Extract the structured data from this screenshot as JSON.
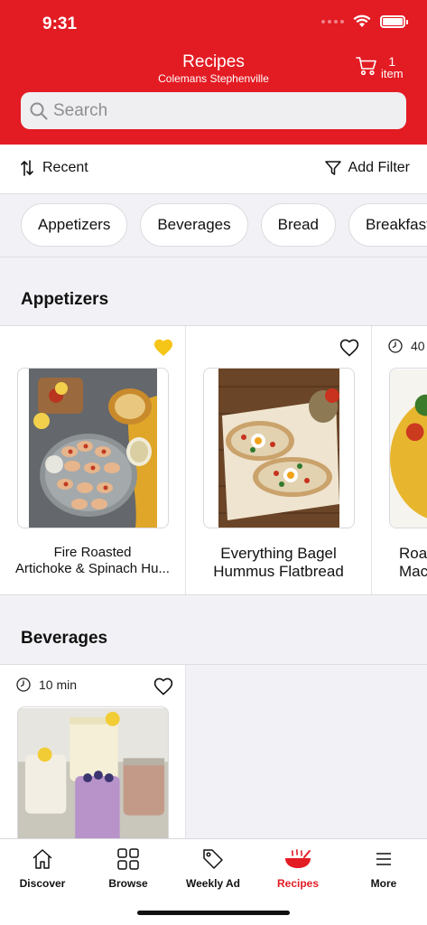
{
  "status": {
    "time": "9:31"
  },
  "header": {
    "title": "Recipes",
    "store": "Colemans Stephenville",
    "cart_count": "1",
    "cart_unit": "item"
  },
  "search": {
    "placeholder": "Search"
  },
  "toolbar": {
    "sort_label": "Recent",
    "filter_label": "Add Filter"
  },
  "categories": [
    "Appetizers",
    "Beverages",
    "Bread",
    "Breakfast"
  ],
  "sections": [
    {
      "title": "Appetizers",
      "recipes": [
        {
          "name_line1": "Fire Roasted",
          "name_line2": "Artichoke & Spinach Hu...",
          "favorited": true,
          "time": ""
        },
        {
          "name_line1": "Everything Bagel",
          "name_line2": "Hummus Flatbread",
          "favorited": false,
          "time": ""
        },
        {
          "name_line1": "Roa",
          "name_line2": "Mac",
          "favorited": false,
          "time": "40"
        }
      ]
    },
    {
      "title": "Beverages",
      "recipes": [
        {
          "name_line1": "",
          "name_line2": "",
          "favorited": false,
          "time": "10 min"
        }
      ]
    }
  ],
  "tabs": [
    {
      "label": "Discover",
      "icon": "home-icon",
      "active": false
    },
    {
      "label": "Browse",
      "icon": "grid-icon",
      "active": false
    },
    {
      "label": "Weekly Ad",
      "icon": "tag-icon",
      "active": false
    },
    {
      "label": "Recipes",
      "icon": "bowl-icon",
      "active": true
    },
    {
      "label": "More",
      "icon": "menu-icon",
      "active": false
    }
  ],
  "colors": {
    "brand": "#e31b23",
    "favorite": "#f5c518"
  }
}
